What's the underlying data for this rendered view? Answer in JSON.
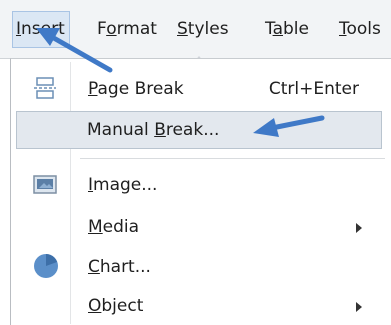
{
  "menubar": {
    "items": [
      {
        "pre": "",
        "key": "I",
        "post": "nsert"
      },
      {
        "pre": "F",
        "key": "o",
        "post": "rmat"
      },
      {
        "pre": "",
        "key": "S",
        "post": "tyles"
      },
      {
        "pre": "T",
        "key": "a",
        "post": "ble"
      },
      {
        "pre": "",
        "key": "T",
        "post": "ools"
      }
    ]
  },
  "menu": {
    "items": [
      {
        "pre": "",
        "key": "P",
        "post": "age Break",
        "shortcut": "Ctrl+Enter",
        "icon": "page-break-icon"
      },
      {
        "pre": "Manual ",
        "key": "B",
        "post": "reak..."
      },
      {
        "pre": "",
        "key": "I",
        "post": "mage...",
        "icon": "image-icon"
      },
      {
        "pre": "",
        "key": "M",
        "post": "edia"
      },
      {
        "pre": "",
        "key": "C",
        "post": "hart...",
        "icon": "chart-icon"
      },
      {
        "pre": "",
        "key": "O",
        "post": "bject"
      }
    ]
  },
  "colors": {
    "accent_arrow": "#3f79c7",
    "highlight_bg": "#e3e8ee"
  }
}
